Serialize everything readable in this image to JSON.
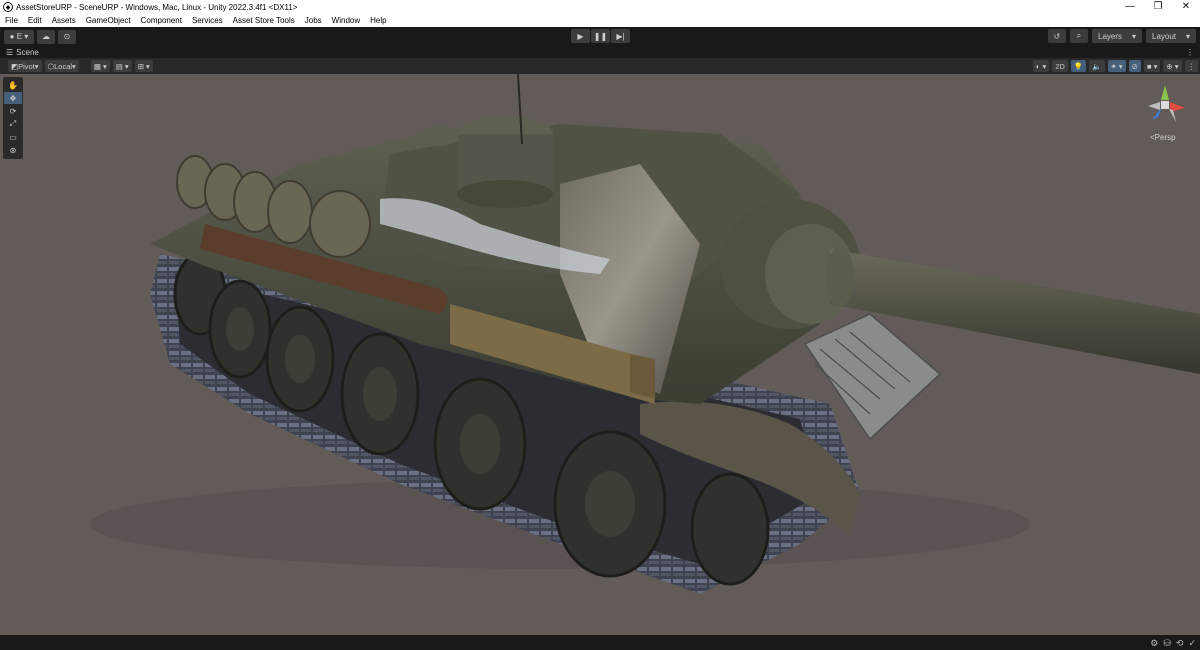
{
  "window": {
    "title": "AssetStoreURP - SceneURP - Windows, Mac, Linux - Unity 2022.3.4f1 <DX11>",
    "controls": [
      "—",
      "❐",
      "✕"
    ]
  },
  "menu": [
    "File",
    "Edit",
    "Assets",
    "GameObject",
    "Component",
    "Services",
    "Asset Store Tools",
    "Jobs",
    "Window",
    "Help"
  ],
  "toolbar": {
    "account_label": "E",
    "layers_label": "Layers",
    "layout_label": "Layout"
  },
  "scene_tab": {
    "label": "Scene"
  },
  "scene_toolbar": {
    "pivot_label": "Pivot",
    "local_label": "Local",
    "mode_2d_label": "2D"
  },
  "tools": [
    "hand",
    "move",
    "rotate",
    "scale",
    "rect",
    "transform"
  ],
  "gizmo": {
    "projection_label": "Persp"
  },
  "colors": {
    "editor_bg": "#191919",
    "viewport_bg": "#625b58",
    "accent": "#46607c"
  }
}
